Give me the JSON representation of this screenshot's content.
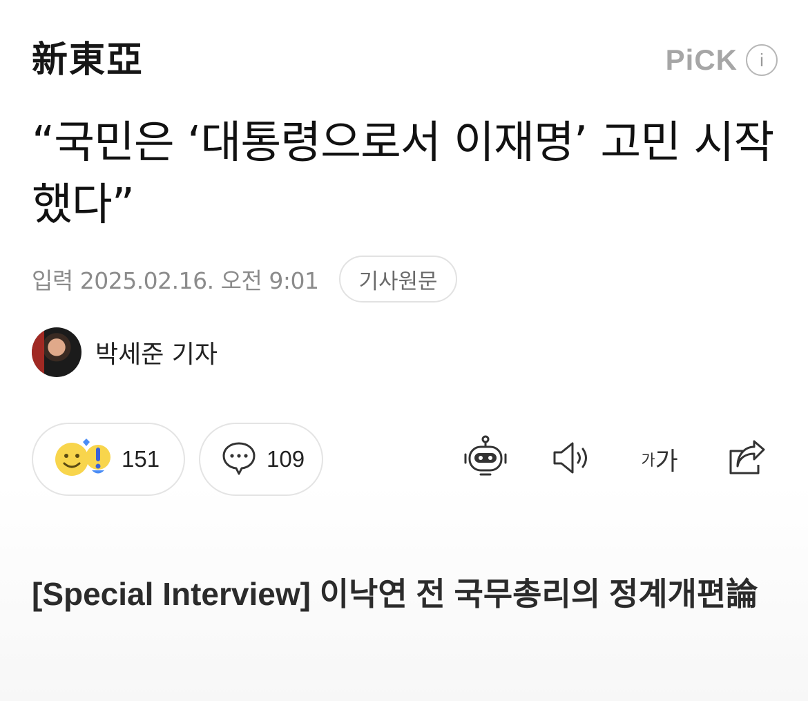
{
  "header": {
    "logo_text": "新東亞",
    "pick_label": "PiCK",
    "info_icon": "i"
  },
  "article": {
    "title": "“국민은 ‘대통령으로서 이재명’ 고민 시작했다”",
    "date": "입력 2025.02.16. 오전 9:01",
    "original_button": "기사원문",
    "author": "박세준 기자",
    "subtitle": "[Special Interview] 이낙연 전 국무총리의 정계개편論"
  },
  "actions": {
    "reaction_count": "151",
    "comment_count": "109",
    "font_small": "가",
    "font_large": "가"
  },
  "icons": {
    "reaction": "reaction-emoji-icon",
    "comment": "comment-bubble-icon",
    "summary": "robot-summary-icon",
    "audio": "speaker-icon",
    "font_size": "font-size-icon",
    "share": "share-icon"
  },
  "colors": {
    "pick_gray": "#a6a6a6",
    "meta_gray": "#8b8b8b",
    "pill_border": "#e4e4e4",
    "reaction_yellow": "#f8d54c",
    "reaction_blue": "#4a8cf5"
  }
}
